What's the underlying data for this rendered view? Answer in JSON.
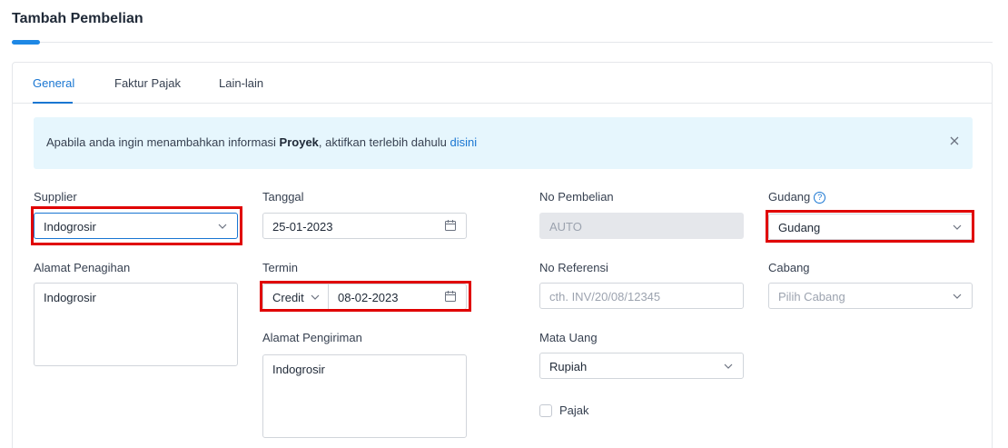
{
  "page": {
    "title": "Tambah Pembelian"
  },
  "tabs": [
    {
      "label": "General",
      "active": true
    },
    {
      "label": "Faktur Pajak",
      "active": false
    },
    {
      "label": "Lain-lain",
      "active": false
    }
  ],
  "alert": {
    "text_before": "Apabila anda ingin menambahkan informasi ",
    "bold": "Proyek",
    "text_after": ", aktifkan terlebih dahulu ",
    "link": "disini"
  },
  "form": {
    "supplier": {
      "label": "Supplier",
      "value": "Indogrosir"
    },
    "alamat_penagihan": {
      "label": "Alamat Penagihan",
      "value": "Indogrosir"
    },
    "tanggal": {
      "label": "Tanggal",
      "value": "25-01-2023"
    },
    "termin": {
      "label": "Termin",
      "type": "Credit",
      "value": "08-02-2023"
    },
    "alamat_pengiriman": {
      "label": "Alamat Pengiriman",
      "value": "Indogrosir"
    },
    "no_pembelian": {
      "label": "No Pembelian",
      "value": "AUTO"
    },
    "no_referensi": {
      "label": "No Referensi",
      "placeholder": "cth. INV/20/08/12345"
    },
    "mata_uang": {
      "label": "Mata Uang",
      "value": "Rupiah"
    },
    "pajak": {
      "label": "Pajak",
      "checked": false
    },
    "gudang": {
      "label": "Gudang",
      "value": "Gudang"
    },
    "cabang": {
      "label": "Cabang",
      "placeholder": "Pilih Cabang"
    }
  },
  "colors": {
    "accent": "#1976d2",
    "highlight": "#e00000",
    "alert_bg": "#e6f6fd"
  }
}
